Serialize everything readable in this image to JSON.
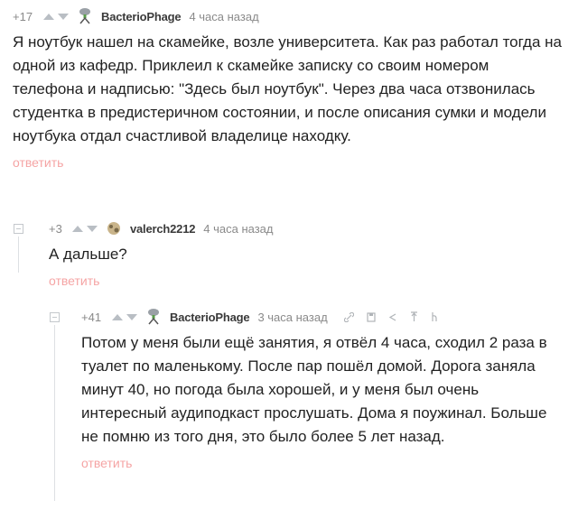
{
  "comments": [
    {
      "rating": "+17",
      "author": "BacterioPhage",
      "time": "4 часа назад",
      "text": "Я ноутбук нашел на скамейке, возле университета. Как раз работал тогда на одной из кафедр. Приклеил к скамейке записку со своим номером телефона и надписью: \"Здесь был ноутбук\". Через два часа отзвонилась студентка в предистеричном состоянии, и после описания сумки и модели ноутбука отдал счастливой владелице находку.",
      "reply_label": "ответить"
    },
    {
      "rating": "+3",
      "author": "valerch2212",
      "time": "4 часа назад",
      "text": "А дальше?",
      "reply_label": "ответить"
    },
    {
      "rating": "+41",
      "author": "BacterioPhage",
      "time": "3 часа назад",
      "text": "Потом у меня были ещё занятия, я отвёл 4 часа, сходил 2 раза в туалет по маленькому. После пар пошёл домой. Дорога заняла минут 40, но погода была хорошей, и у меня был очень интересный аудиподкаст прослушать. Дома я поужинал. Больше не помню из того дня, это было более 5 лет назад.",
      "reply_label": "ответить",
      "actions": [
        "link-icon",
        "save-icon",
        "share-icon",
        "pin-icon",
        "more-icon"
      ]
    }
  ],
  "colors": {
    "reply": "#f5a4a4",
    "meta": "#8a8a8a",
    "arrow": "#b9bec4",
    "line": "#dde0e3"
  }
}
